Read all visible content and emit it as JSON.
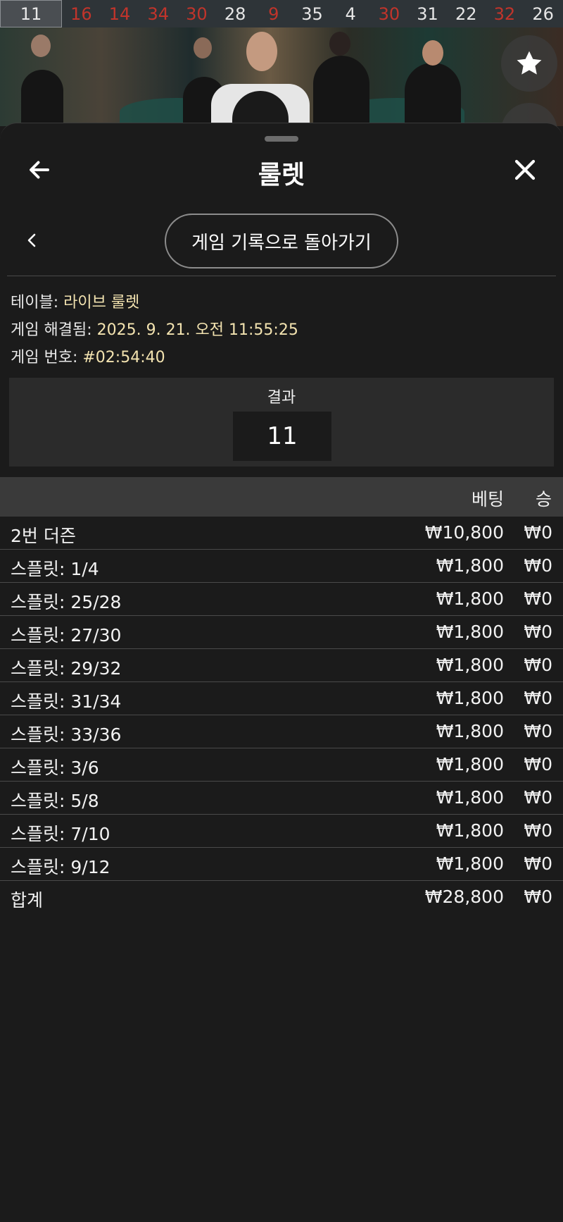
{
  "results_strip": [
    {
      "value": "11",
      "color": "#e8e8e8"
    },
    {
      "value": "16",
      "color": "#c1342b"
    },
    {
      "value": "14",
      "color": "#c1342b"
    },
    {
      "value": "34",
      "color": "#c1342b"
    },
    {
      "value": "30",
      "color": "#c1342b"
    },
    {
      "value": "28",
      "color": "#e6e6e6"
    },
    {
      "value": "9",
      "color": "#c1342b"
    },
    {
      "value": "35",
      "color": "#e6e6e6"
    },
    {
      "value": "4",
      "color": "#e6e6e6"
    },
    {
      "value": "30",
      "color": "#c1342b"
    },
    {
      "value": "31",
      "color": "#e6e6e6"
    },
    {
      "value": "22",
      "color": "#e6e6e6"
    },
    {
      "value": "32",
      "color": "#c1342b"
    },
    {
      "value": "26",
      "color": "#e6e6e6"
    }
  ],
  "header": {
    "title": "룰렛",
    "back_icon": "arrow-left-icon",
    "close_icon": "close-icon"
  },
  "nav": {
    "history_button": "게임 기록으로 돌아가기",
    "chevron_icon": "chevron-left-icon"
  },
  "info": {
    "table_label": "테이블:",
    "table_value": "라이브 룰렛",
    "resolved_label": "게임 해결됨:",
    "resolved_value": "2025. 9. 21. 오전 11:55:25",
    "game_number_label": "게임 번호:",
    "game_number_value": "#02:54:40"
  },
  "result": {
    "label": "결과",
    "value": "11"
  },
  "table": {
    "header_bet": "베팅",
    "header_win": "승",
    "rows": [
      {
        "name": "2번 더즌",
        "bet": "₩10,800",
        "win": "₩0"
      },
      {
        "name": "스플릿: 1/4",
        "bet": "₩1,800",
        "win": "₩0"
      },
      {
        "name": "스플릿: 25/28",
        "bet": "₩1,800",
        "win": "₩0"
      },
      {
        "name": "스플릿: 27/30",
        "bet": "₩1,800",
        "win": "₩0"
      },
      {
        "name": "스플릿: 29/32",
        "bet": "₩1,800",
        "win": "₩0"
      },
      {
        "name": "스플릿: 31/34",
        "bet": "₩1,800",
        "win": "₩0"
      },
      {
        "name": "스플릿: 33/36",
        "bet": "₩1,800",
        "win": "₩0"
      },
      {
        "name": "스플릿: 3/6",
        "bet": "₩1,800",
        "win": "₩0"
      },
      {
        "name": "스플릿: 5/8",
        "bet": "₩1,800",
        "win": "₩0"
      },
      {
        "name": "스플릿: 7/10",
        "bet": "₩1,800",
        "win": "₩0"
      },
      {
        "name": "스플릿: 9/12",
        "bet": "₩1,800",
        "win": "₩0"
      },
      {
        "name": "합계",
        "bet": "₩28,800",
        "win": "₩0"
      }
    ]
  },
  "colors": {
    "red_number": "#c1342b",
    "info_value": "#f3e3b0",
    "sheet_bg": "#1b1b1b"
  }
}
